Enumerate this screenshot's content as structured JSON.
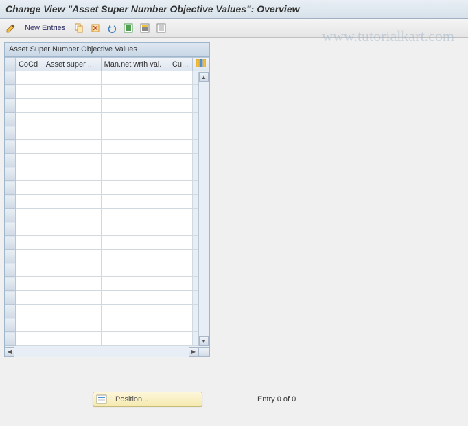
{
  "title": "Change View \"Asset Super Number Objective Values\": Overview",
  "toolbar": {
    "new_entries_label": "New Entries"
  },
  "panel": {
    "title": "Asset Super Number Objective Values",
    "columns": {
      "cocd": "CoCd",
      "asset_super": "Asset super ...",
      "man_net": "Man.net wrth val.",
      "cu": "Cu..."
    },
    "rows": [
      {},
      {},
      {},
      {},
      {},
      {},
      {},
      {},
      {},
      {},
      {},
      {},
      {},
      {},
      {},
      {},
      {},
      {},
      {},
      {}
    ]
  },
  "footer": {
    "position_label": "Position...",
    "entry_text": "Entry 0 of 0"
  },
  "watermark": "www.tutorialkart.com"
}
